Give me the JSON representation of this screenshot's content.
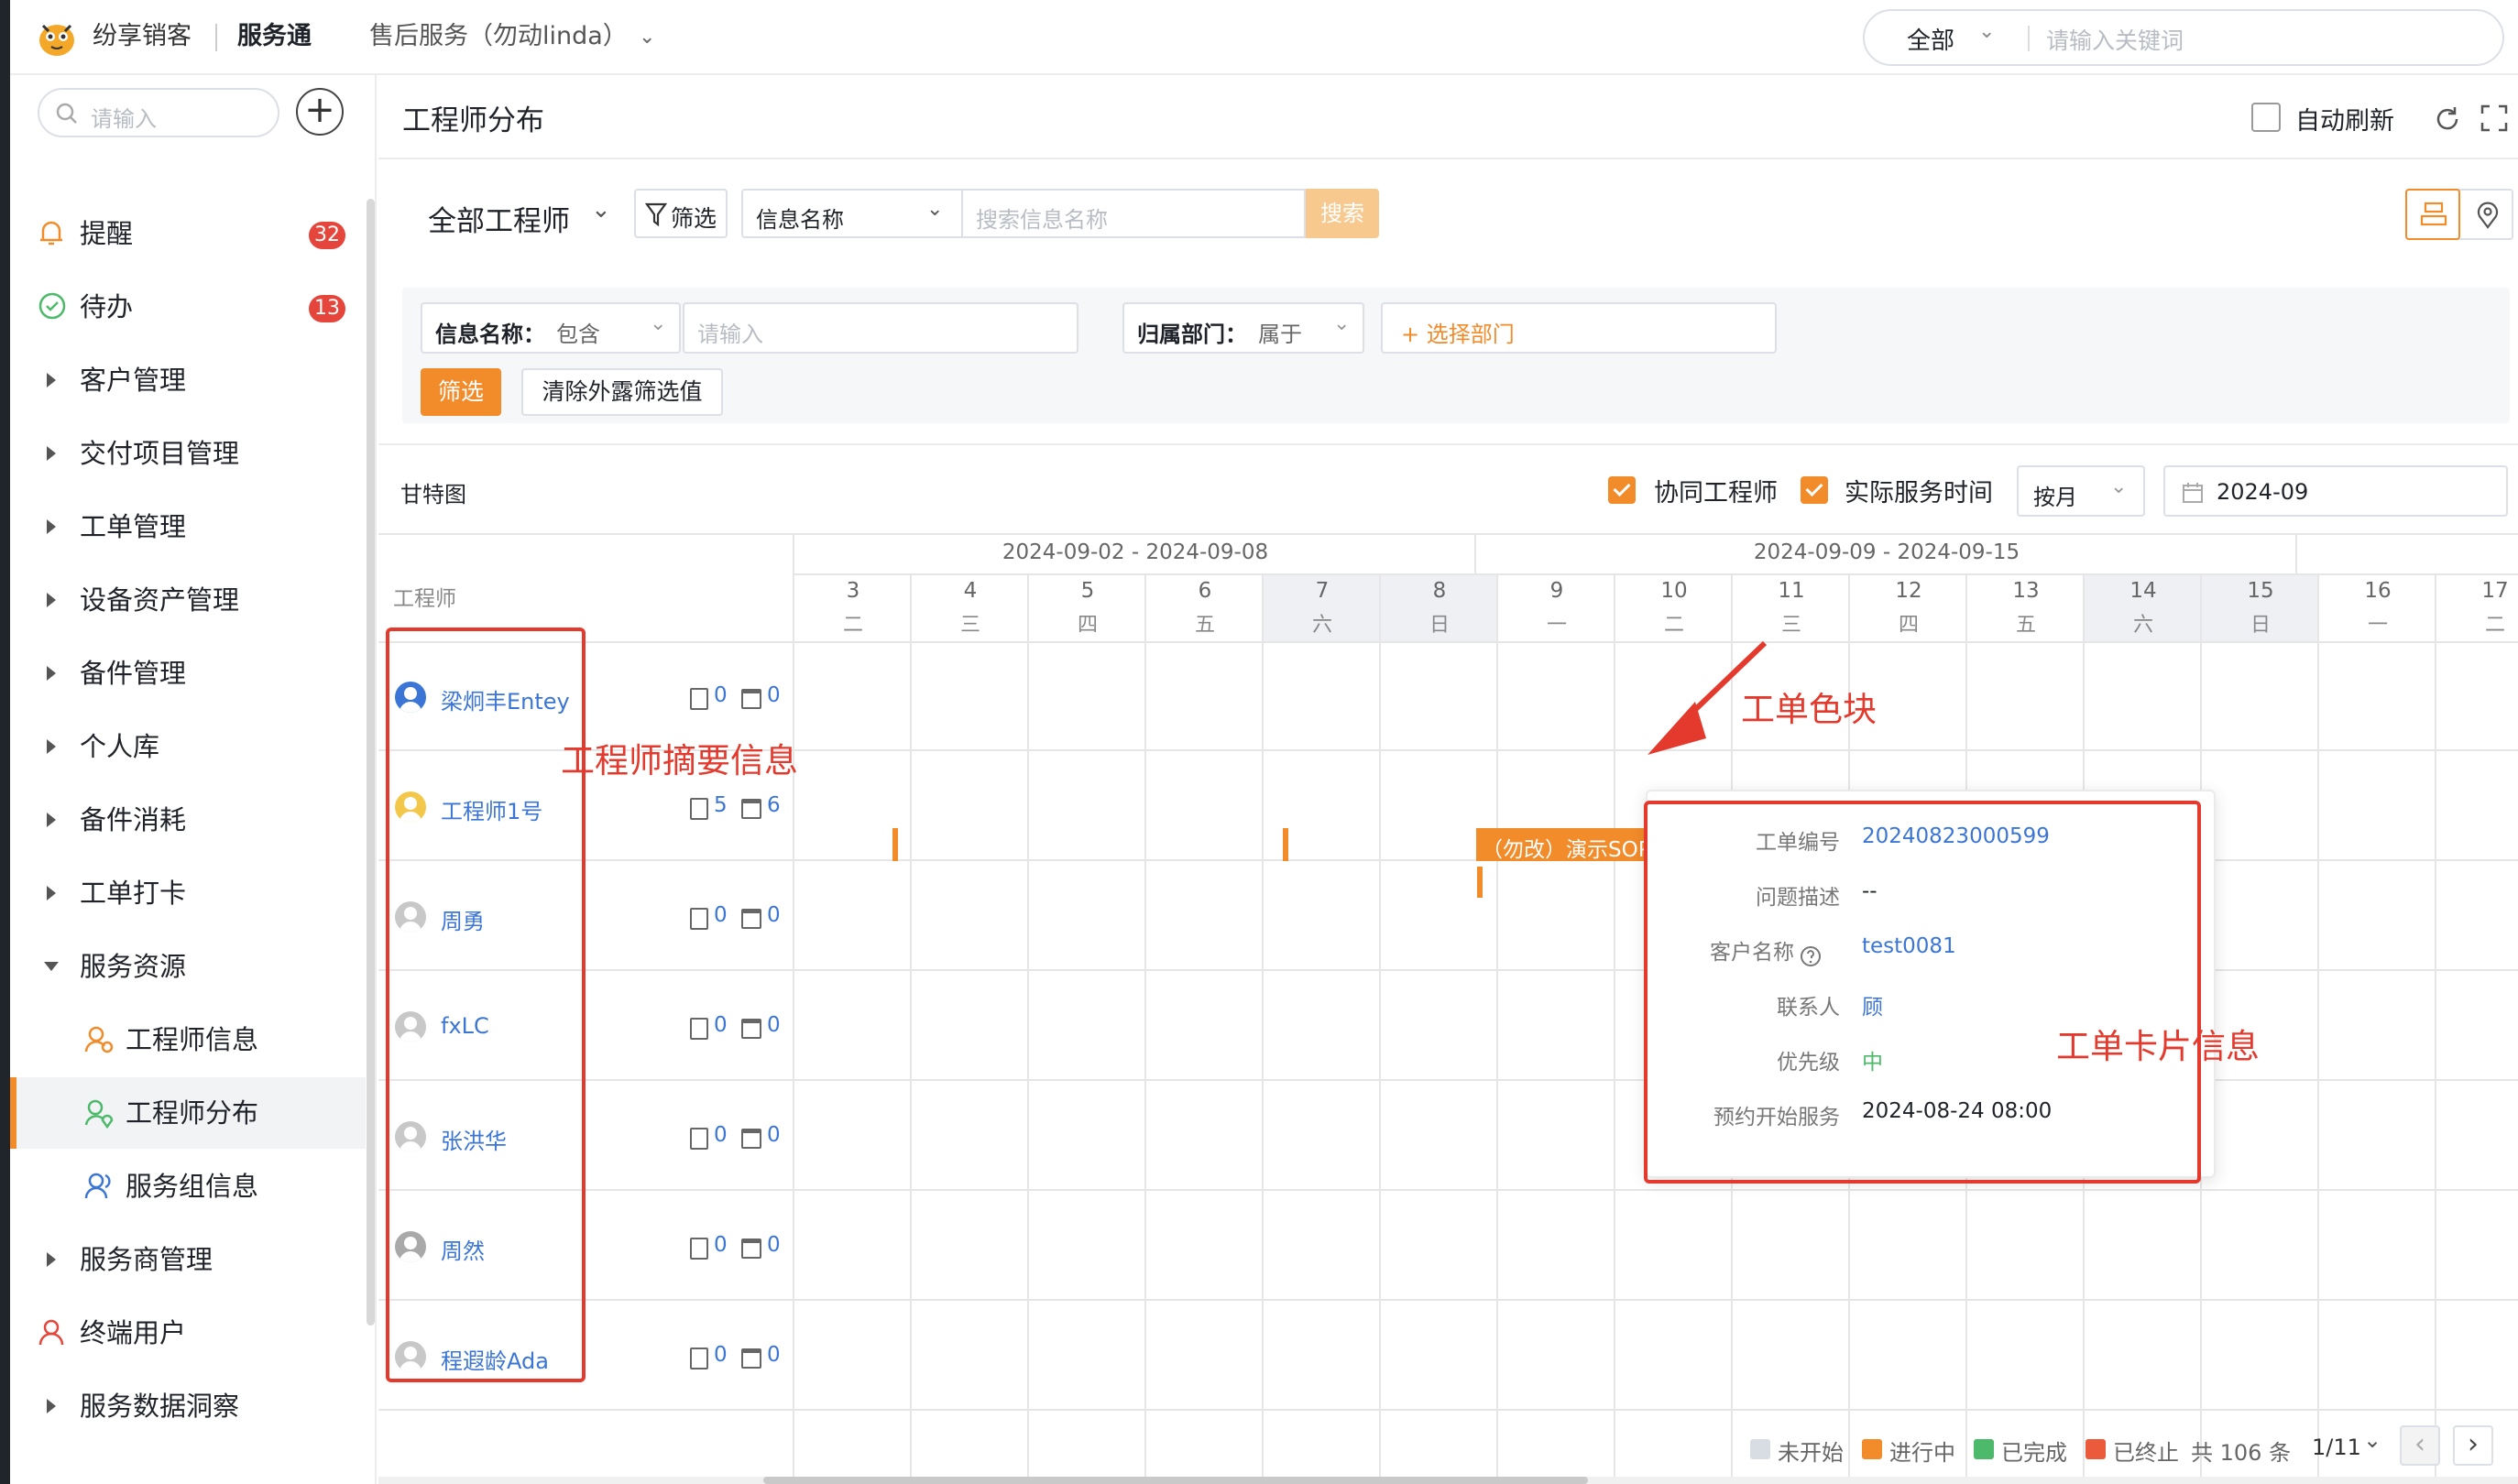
{
  "topbar": {
    "logo_text": "纷享销客",
    "app_name": "服务通",
    "tenant": "售后服务（勿动linda）",
    "scope_select": "全部",
    "search_placeholder": "请输入关键词"
  },
  "sidebar": {
    "search_placeholder": "请输入",
    "items": [
      {
        "label": "提醒",
        "badge": "32",
        "icon": "bell-icon"
      },
      {
        "label": "待办",
        "badge": "13",
        "icon": "check-circle-icon"
      },
      {
        "label": "客户管理"
      },
      {
        "label": "交付项目管理"
      },
      {
        "label": "工单管理"
      },
      {
        "label": "设备资产管理"
      },
      {
        "label": "备件管理"
      },
      {
        "label": "个人库"
      },
      {
        "label": "备件消耗"
      },
      {
        "label": "工单打卡"
      },
      {
        "label": "服务资源",
        "expanded": true
      },
      {
        "label": "工程师信息",
        "icon": "engineer-icon"
      },
      {
        "label": "工程师分布",
        "icon": "location-icon",
        "active": true
      },
      {
        "label": "服务组信息",
        "icon": "group-icon"
      },
      {
        "label": "服务商管理"
      },
      {
        "label": "终端用户",
        "icon": "user-icon"
      },
      {
        "label": "服务数据洞察"
      }
    ]
  },
  "page": {
    "title": "工程师分布",
    "auto_refresh_label": "自动刷新"
  },
  "toolbar": {
    "engineer_select": "全部工程师",
    "filter_btn": "筛选",
    "field_select": "信息名称",
    "search_placeholder": "搜索信息名称",
    "search_btn": "搜索"
  },
  "filters": {
    "f1_label": "信息名称：",
    "f1_op": "包含",
    "f1_placeholder": "请输入",
    "f2_label": "归属部门：",
    "f2_op": "属于",
    "f2_btn": "+ 选择部门",
    "apply_btn": "筛选",
    "clear_btn": "清除外露筛选值"
  },
  "gantt": {
    "title": "甘特图",
    "co_engineer": "协同工程师",
    "actual_time": "实际服务时间",
    "period": "按月",
    "month": "2024-09",
    "engineer_col": "工程师",
    "weeks": [
      "2024-09-02 - 2024-09-08",
      "2024-09-09 - 2024-09-15"
    ],
    "days": [
      {
        "d": "3",
        "w": "二"
      },
      {
        "d": "4",
        "w": "三"
      },
      {
        "d": "5",
        "w": "四"
      },
      {
        "d": "6",
        "w": "五"
      },
      {
        "d": "7",
        "w": "六",
        "we": true
      },
      {
        "d": "8",
        "w": "日",
        "we": true
      },
      {
        "d": "9",
        "w": "一"
      },
      {
        "d": "10",
        "w": "二"
      },
      {
        "d": "11",
        "w": "三"
      },
      {
        "d": "12",
        "w": "四"
      },
      {
        "d": "13",
        "w": "五"
      },
      {
        "d": "14",
        "w": "六",
        "we": true
      },
      {
        "d": "15",
        "w": "日",
        "we": true
      },
      {
        "d": "16",
        "w": "一"
      },
      {
        "d": "17",
        "w": "二"
      }
    ],
    "engineers": [
      {
        "name": "梁炯丰Entey",
        "a": "0",
        "b": "0"
      },
      {
        "name": "工程师1号",
        "a": "5",
        "b": "6"
      },
      {
        "name": "周勇",
        "a": "0",
        "b": "0"
      },
      {
        "name": "fxLC",
        "a": "0",
        "b": "0"
      },
      {
        "name": "张洪华",
        "a": "0",
        "b": "0"
      },
      {
        "name": "周然",
        "a": "0",
        "b": "0"
      },
      {
        "name": "程遐龄Ada",
        "a": "0",
        "b": "0"
      }
    ],
    "task_label": "（勿改）演示SOP-设备"
  },
  "card": {
    "rows": [
      {
        "k": "工单编号",
        "v": "20240823000599",
        "link": true
      },
      {
        "k": "问题描述",
        "v": "--"
      },
      {
        "k": "客户名称",
        "v": "test0081",
        "link": true
      },
      {
        "k": "联系人",
        "v": "顾",
        "link": true
      },
      {
        "k": "优先级",
        "v": "中",
        "green": true
      },
      {
        "k": "预约开始服务",
        "v": "2024-08-24 08:00"
      }
    ]
  },
  "annotations": {
    "engineer_summary": "工程师摘要信息",
    "task_block": "工单色块",
    "card_info": "工单卡片信息"
  },
  "footer": {
    "legend": [
      "未开始",
      "进行中",
      "已完成",
      "已终止"
    ],
    "total": "共 106 条",
    "page": "1/11"
  },
  "colors": {
    "accent": "#f28b2a",
    "link": "#3b76d6",
    "annotation": "#e33a2d",
    "done": "#4cba6a",
    "terminated": "#ec5a3c",
    "not_started": "#d8dce3"
  }
}
